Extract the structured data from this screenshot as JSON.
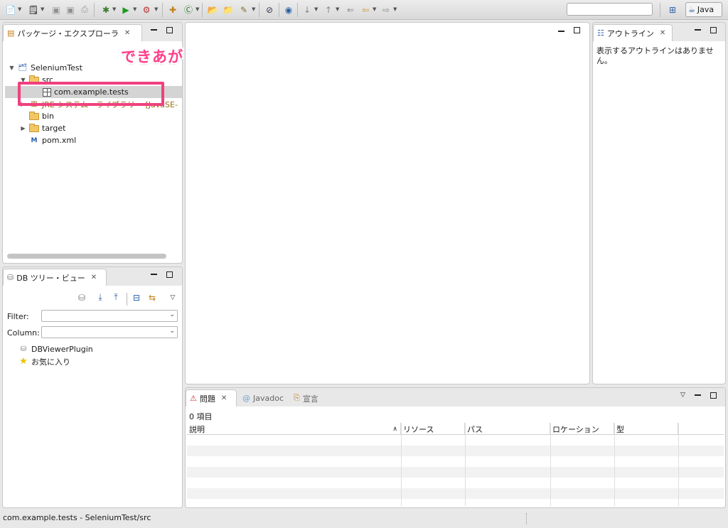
{
  "package_explorer": {
    "title": "パッケージ・エクスプローラ",
    "tree": [
      {
        "label": "SeleniumTest"
      },
      {
        "label": "src"
      },
      {
        "label": "com.example.tests"
      },
      {
        "label": "JRE システム・ライブラリー [JavaSE-"
      },
      {
        "label": "bin"
      },
      {
        "label": "target"
      },
      {
        "label": "pom.xml"
      }
    ]
  },
  "annotation": {
    "text": "できあがり♥",
    "color": "#ff3e8a"
  },
  "db_tree": {
    "title": "DB ツリー・ビュー",
    "filter_label": "Filter:",
    "column_label": "Column:",
    "items": [
      {
        "label": "DBViewerPlugin"
      },
      {
        "label": "お気に入り"
      }
    ]
  },
  "outline": {
    "title": "アウトライン",
    "message": "表示するアウトラインはありません。"
  },
  "problems": {
    "tabs": [
      {
        "label": "問題"
      },
      {
        "label": "Javadoc"
      },
      {
        "label": "宣言"
      }
    ],
    "count": "0 項目",
    "columns": [
      "説明",
      "リソース",
      "パス",
      "ロケーション",
      "型"
    ]
  },
  "toolbar": {
    "perspective": "Java"
  },
  "status": {
    "text": "com.example.tests - SeleniumTest/src"
  }
}
